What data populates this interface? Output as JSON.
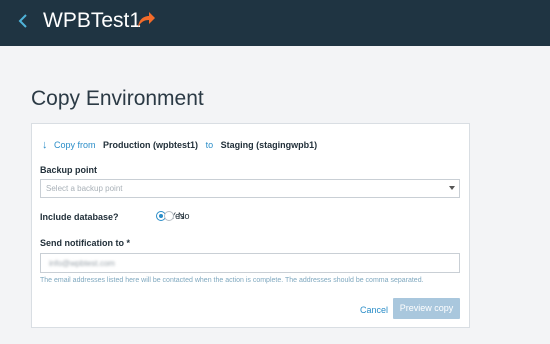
{
  "header": {
    "site_name": "WPBTest1",
    "back_icon": "chevron-left-icon",
    "visit_icon": "arrow-forward-icon",
    "accent_color": "#f26b2a",
    "bar_color": "#1f3442"
  },
  "page": {
    "title": "Copy Environment"
  },
  "copy": {
    "arrow": "↓",
    "from_label": "Copy from",
    "source": "Production (wpbtest1)",
    "to_label": "to",
    "target": "Staging (stagingwpb1)"
  },
  "backup": {
    "label": "Backup point",
    "placeholder": "Select a backup point"
  },
  "database": {
    "label": "Include database?",
    "options": [
      {
        "label": "Yes",
        "selected": true
      },
      {
        "label": "No",
        "selected": false
      }
    ]
  },
  "notification": {
    "label": "Send notification to *",
    "value": "info@wpbtest.com",
    "hint": "The email addresses listed here will be contacted when the action is complete. The addresses should be comma separated."
  },
  "actions": {
    "cancel": "Cancel",
    "preview": "Preview copy"
  },
  "colors": {
    "link": "#2a8dc8",
    "disabled_button": "#a9c7dd"
  }
}
